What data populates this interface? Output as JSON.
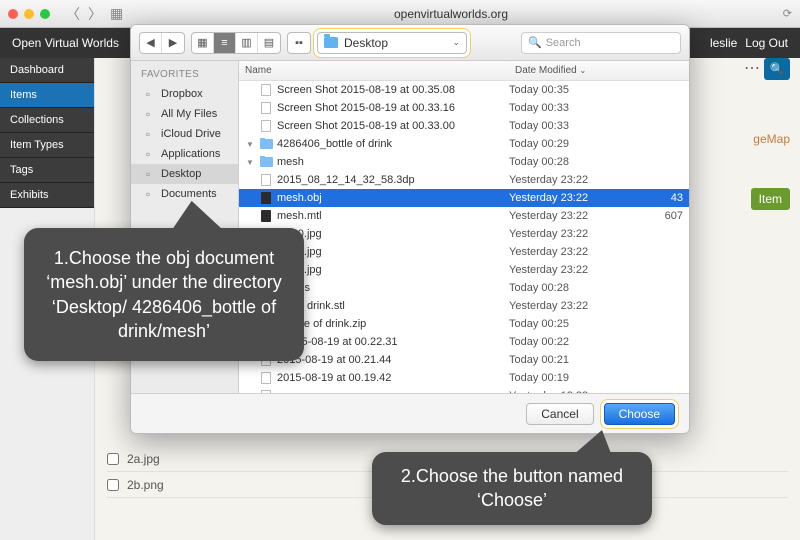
{
  "safari": {
    "address": "openvirtualworlds.org"
  },
  "page": {
    "brand": "Open Virtual Worlds",
    "user": "leslie",
    "logout": "Log Out",
    "menu": [
      "Dashboard",
      "Items",
      "Collections",
      "Item Types",
      "Tags",
      "Exhibits"
    ],
    "menu_active_index": 1,
    "add_item_label": "Item",
    "sidebar_partial": "geMap",
    "list_items": [
      "2a.jpg",
      "2b.png"
    ]
  },
  "dialog": {
    "location": "Desktop",
    "search_placeholder": "Search",
    "sidebar_header": "Favorites",
    "sidebar": [
      {
        "label": "Dropbox",
        "icon": "dropbox-icon"
      },
      {
        "label": "All My Files",
        "icon": "all-files-icon"
      },
      {
        "label": "iCloud Drive",
        "icon": "icloud-icon"
      },
      {
        "label": "Applications",
        "icon": "apps-icon"
      },
      {
        "label": "Desktop",
        "icon": "desktop-icon",
        "selected": true
      },
      {
        "label": "Documents",
        "icon": "documents-icon"
      }
    ],
    "columns": {
      "name": "Name",
      "date": "Date Modified",
      "size": ""
    },
    "rows": [
      {
        "name": "Screen Shot 2015-08-19 at 00.35.08",
        "date": "Today 00:35",
        "size": "",
        "indent": 1,
        "icon": "doc"
      },
      {
        "name": "Screen Shot 2015-08-19 at 00.33.16",
        "date": "Today 00:33",
        "size": "",
        "indent": 1,
        "icon": "doc"
      },
      {
        "name": "Screen Shot 2015-08-19 at 00.33.00",
        "date": "Today 00:33",
        "size": "",
        "indent": 1,
        "icon": "doc"
      },
      {
        "name": "4286406_bottle of drink",
        "date": "Today 00:29",
        "size": "",
        "indent": 0,
        "icon": "folder",
        "disclosure": "down"
      },
      {
        "name": "mesh",
        "date": "Today 00:28",
        "size": "",
        "indent": 1,
        "icon": "folder",
        "disclosure": "down"
      },
      {
        "name": "2015_08_12_14_32_58.3dp",
        "date": "Yesterday 23:22",
        "size": "",
        "indent": 2,
        "icon": "doc"
      },
      {
        "name": "mesh.obj",
        "date": "Yesterday 23:22",
        "size": "43",
        "indent": 2,
        "icon": "dark",
        "selected": true
      },
      {
        "name": "mesh.mtl",
        "date": "Yesterday 23:22",
        "size": "607",
        "indent": 2,
        "icon": "dark"
      },
      {
        "name": "tex_0.jpg",
        "date": "Yesterday 23:22",
        "size": "",
        "indent": 2,
        "icon": "img"
      },
      {
        "name": "tex_1.jpg",
        "date": "Yesterday 23:22",
        "size": "",
        "indent": 2,
        "icon": "img"
      },
      {
        "name": "tex_2.jpg",
        "date": "Yesterday 23:22",
        "size": "",
        "indent": 2,
        "icon": "img"
      },
      {
        "name": "photos",
        "date": "Today 00:28",
        "size": "",
        "indent": 1,
        "icon": "folder",
        "disclosure": "right"
      },
      {
        "name": "ttle of drink.stl",
        "date": "Yesterday 23:22",
        "size": "",
        "indent": 1,
        "icon": "doc"
      },
      {
        "name": "_bottle of drink.zip",
        "date": "Today 00:25",
        "size": "",
        "indent": 1,
        "icon": "doc"
      },
      {
        "name": "t 2015-08-19 at 00.22.31",
        "date": "Today 00:22",
        "size": "",
        "indent": 1,
        "icon": "doc"
      },
      {
        "name": "2015-08-19 at 00.21.44",
        "date": "Today 00:21",
        "size": "",
        "indent": 1,
        "icon": "doc"
      },
      {
        "name": "2015-08-19 at 00.19.42",
        "date": "Today 00:19",
        "size": "",
        "indent": 1,
        "icon": "doc"
      },
      {
        "name": "",
        "date": "Yesterday 18:23",
        "size": "",
        "indent": 1,
        "icon": "doc"
      }
    ],
    "cancel_label": "Cancel",
    "choose_label": "Choose"
  },
  "callouts": {
    "c1": "1.Choose the obj document ‘mesh.obj’ under the directory ‘Desktop/ 4286406_bottle of drink/mesh’",
    "c2": "2.Choose the button named ‘Choose’"
  }
}
